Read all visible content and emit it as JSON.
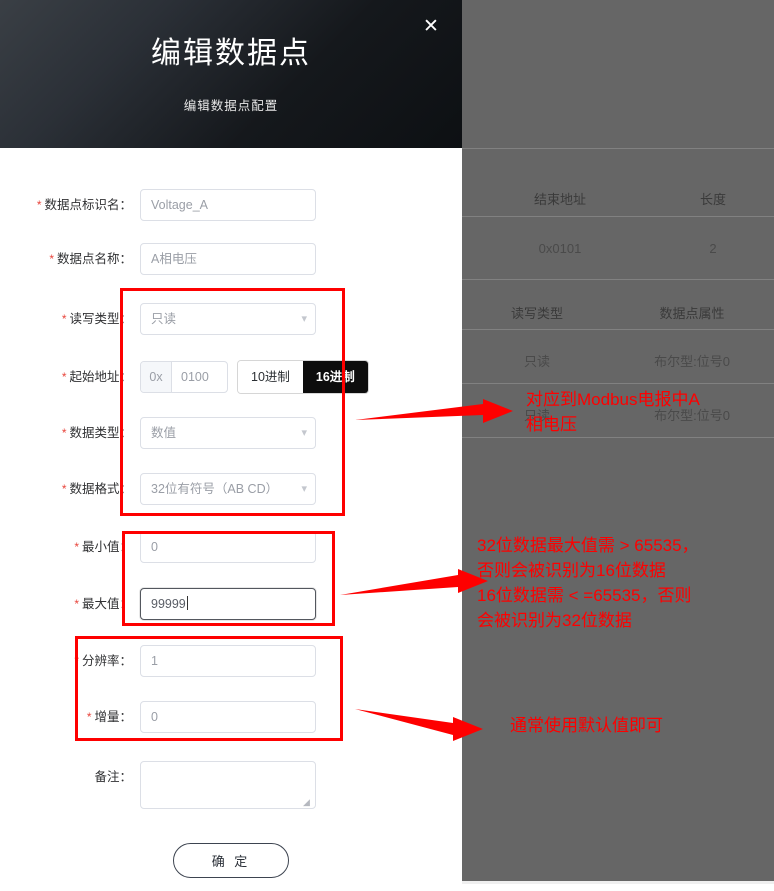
{
  "modal": {
    "title": "编辑数据点",
    "subtitle": "编辑数据点配置",
    "close_label": "✕",
    "submit_label": "确 定"
  },
  "form": {
    "fields": [
      {
        "label": "数据点标识名：",
        "required": true,
        "value": "Voltage_A",
        "type": "text"
      },
      {
        "label": "数据点名称：",
        "required": true,
        "value": "A相电压",
        "type": "text"
      },
      {
        "label": "读写类型：",
        "required": true,
        "value": "只读",
        "type": "select"
      },
      {
        "label": "起始地址：",
        "required": true,
        "value": "0100",
        "type": "address"
      },
      {
        "label": "数据类型：",
        "required": true,
        "value": "数值",
        "type": "select"
      },
      {
        "label": "数据格式：",
        "required": true,
        "value": "32位有符号（AB CD）",
        "type": "select"
      },
      {
        "label": "最小值：",
        "required": true,
        "value": "0",
        "type": "text"
      },
      {
        "label": "最大值：",
        "required": true,
        "value": "99999",
        "type": "text",
        "focused": true
      },
      {
        "label": "分辨率：",
        "required": true,
        "value": "1",
        "type": "text"
      },
      {
        "label": "增量：",
        "required": true,
        "value": "0",
        "type": "text"
      },
      {
        "label": "备注：",
        "required": false,
        "value": "",
        "type": "textarea"
      }
    ],
    "address": {
      "prefix": "0x",
      "value": "0100",
      "radix_options": [
        "10进制",
        "16进制"
      ],
      "radix_selected": "16进制"
    }
  },
  "annotations": {
    "color": "#fe0000",
    "notes": [
      {
        "id": "note-modbus",
        "text": "对应到Modbus电报中A\n相电压"
      },
      {
        "id": "note-bitwidth",
        "text": "32位数据最大值需 > 65535，\n否则会被识别为16位数据\n16位数据需 < =65535，否则\n会被识别为32位数据"
      },
      {
        "id": "note-defaults",
        "text": "通常使用默认值即可"
      }
    ]
  },
  "background_table": {
    "section_one": {
      "headers": [
        "结束地址",
        "长度"
      ],
      "rows": [
        [
          "0x0101",
          "2"
        ]
      ]
    },
    "section_two": {
      "headers": [
        "读写类型",
        "数据点属性"
      ],
      "rows": [
        [
          "只读",
          "布尔型:位号0"
        ],
        [
          "只读",
          "布尔型:位号0"
        ]
      ]
    }
  }
}
